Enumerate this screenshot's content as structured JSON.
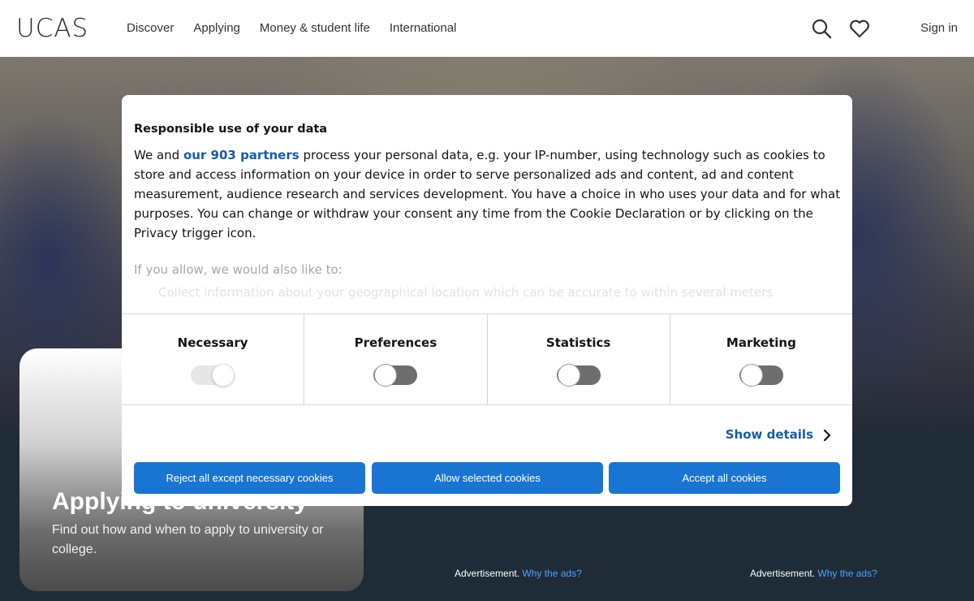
{
  "header": {
    "logo": "UCAS",
    "nav": [
      "Discover",
      "Applying",
      "Money & student life",
      "International"
    ],
    "sign_in": "Sign in",
    "icons": [
      "search-icon",
      "heart-icon"
    ]
  },
  "card": {
    "title": "Applying to university",
    "description": "Find out how and when to apply to university or college."
  },
  "ads": [
    {
      "label": "Advertisement.",
      "link": "Why the ads?"
    },
    {
      "label": "Advertisement.",
      "link": "Why the ads?"
    }
  ],
  "consent": {
    "title": "Responsible use of your data",
    "body_before": "We and ",
    "partners_link": "our 903 partners",
    "body_after": " process your personal data, e.g. your IP-number, using technology such as cookies to store and access information on your device in order to serve personalized ads and content, ad and content measurement, audience research and services development. You have a choice in who uses your data and for what purposes. You can change or withdraw your consent any time from the Cookie Declaration or by clicking on the Privacy trigger icon.",
    "also_like": "If you allow, we would also like to:",
    "bullet_1": "Collect information about your geographical location which can be accurate to within several meters",
    "categories": [
      {
        "label": "Necessary",
        "enabled": true
      },
      {
        "label": "Preferences",
        "enabled": false
      },
      {
        "label": "Statistics",
        "enabled": false
      },
      {
        "label": "Marketing",
        "enabled": false
      }
    ],
    "show_details": "Show details",
    "buttons": {
      "reject": "Reject all except necessary cookies",
      "allow_selected": "Allow selected cookies",
      "accept_all": "Accept all cookies"
    },
    "button_color": "#1a75d2",
    "link_color": "#1a5ba8"
  }
}
